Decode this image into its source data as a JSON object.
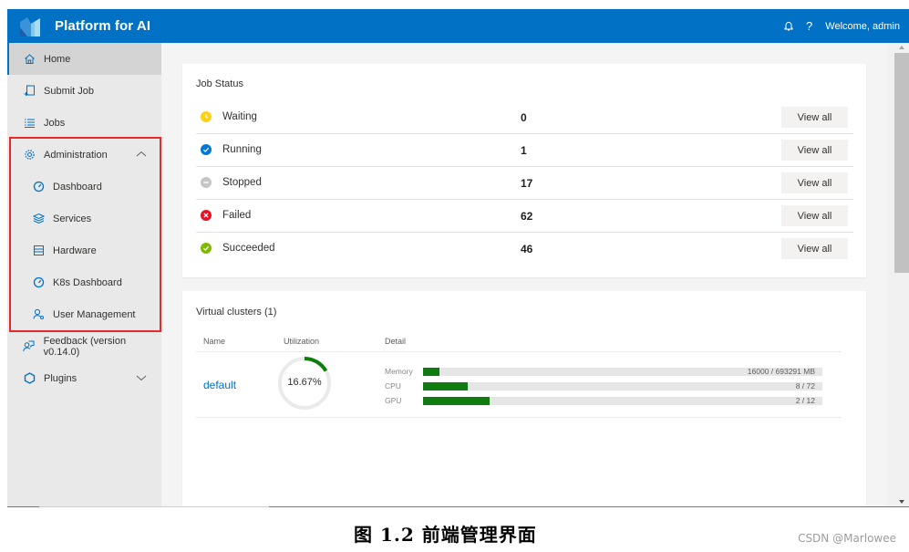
{
  "header": {
    "title": "Platform for AI",
    "welcome": "Welcome, admin",
    "help_label": "?",
    "icons": {
      "logo": "platform-logo",
      "notification": "bell-icon",
      "help": "help-icon"
    }
  },
  "sidebar": {
    "items": [
      {
        "label": "Home",
        "icon": "home-icon",
        "active": true
      },
      {
        "label": "Submit Job",
        "icon": "submit-job-icon"
      },
      {
        "label": "Jobs",
        "icon": "list-icon"
      },
      {
        "label": "Administration",
        "icon": "gear-icon",
        "expanded": true,
        "children": [
          {
            "label": "Dashboard",
            "icon": "gauge-icon"
          },
          {
            "label": "Services",
            "icon": "stack-icon"
          },
          {
            "label": "Hardware",
            "icon": "table-icon"
          },
          {
            "label": "K8s Dashboard",
            "icon": "gauge-icon"
          },
          {
            "label": "User Management",
            "icon": "user-settings-icon"
          }
        ]
      },
      {
        "label": "Feedback (version v0.14.0)",
        "icon": "feedback-icon"
      },
      {
        "label": "Plugins",
        "icon": "puzzle-icon",
        "expanded": false
      }
    ]
  },
  "job_status": {
    "title": "Job Status",
    "rows": [
      {
        "label": "Waiting",
        "count": "0",
        "button": "View all",
        "color": "#fcd116",
        "icon": "clock-icon"
      },
      {
        "label": "Running",
        "count": "1",
        "button": "View all",
        "color": "#0078d4",
        "icon": "check-icon"
      },
      {
        "label": "Stopped",
        "count": "17",
        "button": "View all",
        "color": "#c8c6c4",
        "icon": "minus-icon"
      },
      {
        "label": "Failed",
        "count": "62",
        "button": "View all",
        "color": "#e81123",
        "icon": "x-icon"
      },
      {
        "label": "Succeeded",
        "count": "46",
        "button": "View all",
        "color": "#7fba00",
        "icon": "check-icon"
      }
    ]
  },
  "virtual_clusters": {
    "title": "Virtual clusters (1)",
    "columns": {
      "name": "Name",
      "utilization": "Utilization",
      "detail": "Detail"
    },
    "clusters": [
      {
        "name": "default",
        "utilization_text": "16.67%",
        "utilization": 0.1667,
        "resources": [
          {
            "label": "Memory",
            "value": "16000 / 693291 MB",
            "used": 16000,
            "total": 693291
          },
          {
            "label": "CPU",
            "value": "8 / 72",
            "used": 8,
            "total": 72
          },
          {
            "label": "GPU",
            "value": "2 / 12",
            "used": 2,
            "total": 12
          }
        ]
      }
    ]
  },
  "colors": {
    "brand": "#0071c5",
    "progress": "#107c10",
    "highlight": "#e8282b"
  },
  "caption": "图 1.2  前端管理界面",
  "watermark": "CSDN @Marlowee"
}
